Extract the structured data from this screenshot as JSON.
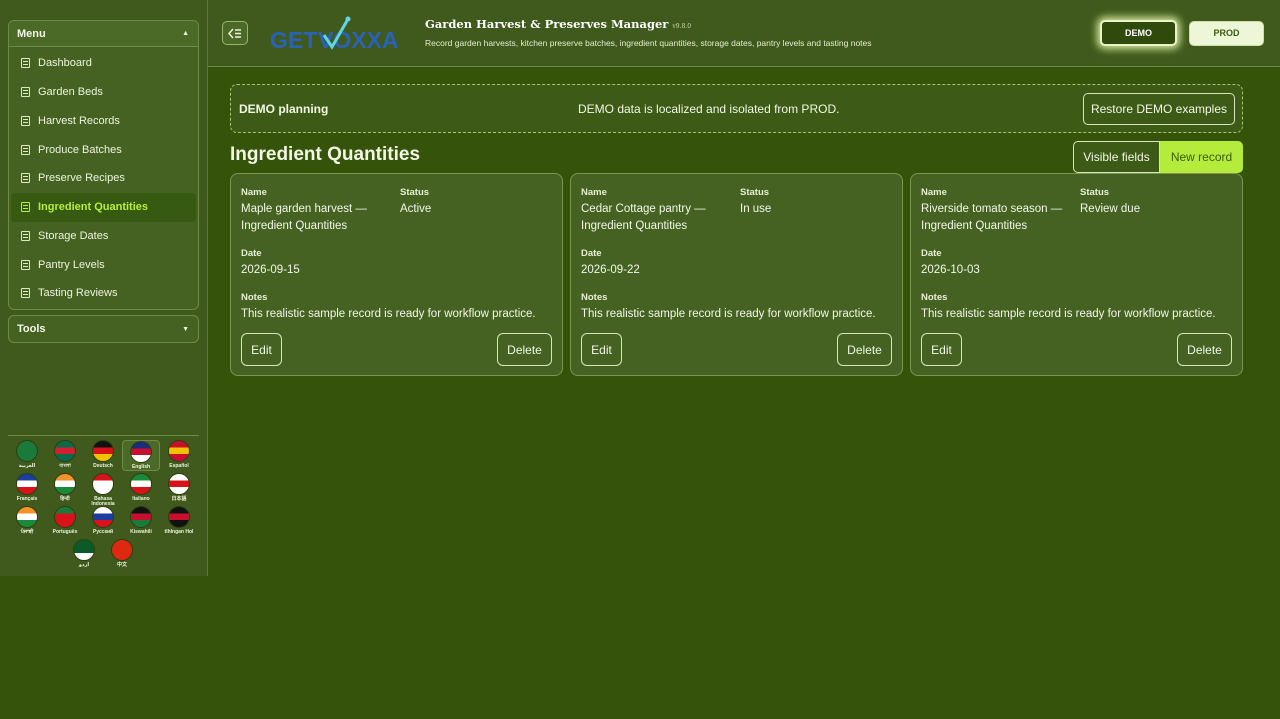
{
  "sidebar": {
    "menu_title": "Menu",
    "items": [
      {
        "label": "Dashboard",
        "active": false
      },
      {
        "label": "Garden Beds",
        "active": false
      },
      {
        "label": "Harvest Records",
        "active": false
      },
      {
        "label": "Produce Batches",
        "active": false
      },
      {
        "label": "Preserve Recipes",
        "active": false
      },
      {
        "label": "Ingredient Quantities",
        "active": true
      },
      {
        "label": "Storage Dates",
        "active": false
      },
      {
        "label": "Pantry Levels",
        "active": false
      },
      {
        "label": "Tasting Reviews",
        "active": false
      }
    ],
    "tools_title": "Tools"
  },
  "languages": [
    {
      "label": "العربية",
      "colors": [
        "#1a7a3a",
        "#1a7a3a",
        "#1a7a3a"
      ]
    },
    {
      "label": "বাংলা",
      "colors": [
        "#0b6a4a",
        "#d22030",
        "#0b6a4a"
      ]
    },
    {
      "label": "Deutsch",
      "colors": [
        "#111111",
        "#d8111a",
        "#f2c200"
      ]
    },
    {
      "label": "English",
      "colors": [
        "#1b2d7a",
        "#c8102e",
        "#ffffff"
      ],
      "active": true
    },
    {
      "label": "Español",
      "colors": [
        "#c8102e",
        "#f2c200",
        "#c8102e"
      ]
    },
    {
      "label": "Français",
      "colors": [
        "#1b3fa0",
        "#ffffff",
        "#d8111a"
      ]
    },
    {
      "label": "हिन्दी",
      "colors": [
        "#f2922a",
        "#ffffff",
        "#1a8a3a"
      ]
    },
    {
      "label": "Bahasa Indonesia",
      "colors": [
        "#d8111a",
        "#ffffff",
        "#ffffff"
      ]
    },
    {
      "label": "Italiano",
      "colors": [
        "#1a8a3a",
        "#ffffff",
        "#d8111a"
      ]
    },
    {
      "label": "日本語",
      "colors": [
        "#ffffff",
        "#d8111a",
        "#ffffff"
      ]
    },
    {
      "label": "ਪੰਜਾਬੀ",
      "colors": [
        "#f2922a",
        "#ffffff",
        "#1a8a3a"
      ]
    },
    {
      "label": "Português",
      "colors": [
        "#1a7a3a",
        "#d8111a",
        "#d8111a"
      ]
    },
    {
      "label": "Русский",
      "colors": [
        "#ffffff",
        "#1b3fa0",
        "#d8111a"
      ]
    },
    {
      "label": "Kiswahili",
      "colors": [
        "#111111",
        "#c8102e",
        "#1a7a3a"
      ]
    },
    {
      "label": "tlhIngan Hol",
      "colors": [
        "#111111",
        "#c8102e",
        "#111111"
      ]
    },
    {
      "label": "اردو",
      "colors": [
        "#0b5a2a",
        "#0b5a2a",
        "#ffffff"
      ]
    },
    {
      "label": "中文",
      "colors": [
        "#de2910",
        "#de2910",
        "#de2910"
      ]
    }
  ],
  "header": {
    "logo_text_get": "GET",
    "logo_text_voxxa": "VOXXA",
    "title": "Garden Harvest & Preserves Manager",
    "version": "v9.8.0",
    "subtitle": "Record garden harvests, kitchen preserve batches, ingredient quantities, storage dates, pantry levels and tasting notes",
    "env_demo": "DEMO",
    "env_prod": "PROD"
  },
  "banner": {
    "title": "DEMO planning",
    "message": "DEMO data is localized and isolated from PROD.",
    "restore_label": "Restore DEMO examples"
  },
  "page": {
    "title": "Ingredient Quantities",
    "visible_fields_label": "Visible fields",
    "new_record_label": "New record"
  },
  "field_labels": {
    "name": "Name",
    "status": "Status",
    "date": "Date",
    "notes": "Notes",
    "edit": "Edit",
    "delete": "Delete"
  },
  "records": [
    {
      "name_line1": "Maple garden harvest —",
      "name_line2": "Ingredient Quantities",
      "status": "Active",
      "date": "2026-09-15",
      "notes": "This realistic sample record is ready for workflow practice."
    },
    {
      "name_line1": "Cedar Cottage pantry —",
      "name_line2": "Ingredient Quantities",
      "status": "In use",
      "date": "2026-09-22",
      "notes": "This realistic sample record is ready for workflow practice."
    },
    {
      "name_line1": "Riverside tomato season —",
      "name_line2": "Ingredient Quantities",
      "status": "Review due",
      "date": "2026-10-03",
      "notes": "This realistic sample record is ready for workflow practice."
    }
  ]
}
